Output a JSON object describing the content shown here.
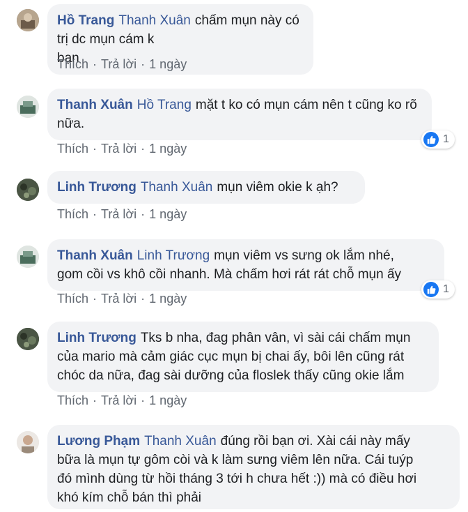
{
  "comments": [
    {
      "author": "Hồ Trang",
      "mention": "Thanh Xuân",
      "text_lines": [
        "chấm mụn này có trị dc mụn cám k",
        "bạn"
      ],
      "actions": {
        "like": "Thích",
        "reply": "Trả lời",
        "time": "1 ngày"
      },
      "reactions": null
    },
    {
      "author": "Thanh Xuân",
      "mention": "Hồ Trang",
      "text_lines": [
        "mặt t ko có mụn cám nên t cũng ko rõ",
        "nữa."
      ],
      "actions": {
        "like": "Thích",
        "reply": "Trả lời",
        "time": "1 ngày"
      },
      "reactions": {
        "icon": "like-icon",
        "count": "1"
      }
    },
    {
      "author": "Linh Trương",
      "mention": "Thanh Xuân",
      "text_lines": [
        "mụn viêm okie k ạh?"
      ],
      "actions": {
        "like": "Thích",
        "reply": "Trả lời",
        "time": "1 ngày"
      },
      "reactions": null
    },
    {
      "author": "Thanh Xuân",
      "mention": "Linh Trương",
      "text_lines": [
        "mụn viêm vs sưng ok lắm nhé,",
        "gom cồi vs khô cồi nhanh. Mà chấm hơi rát rát chỗ mụn ấy"
      ],
      "actions": {
        "like": "Thích",
        "reply": "Trả lời",
        "time": "1 ngày"
      },
      "reactions": {
        "icon": "like-icon",
        "count": "1"
      }
    },
    {
      "author": "Linh Trương",
      "mention": "",
      "text_lines": [
        "Tks b nha, đag phân vân, vì sài cái chấm mụn",
        "của mario mà cảm giác cục mụn bị chai ấy, bôi lên cũng rát",
        "chóc da nữa, đag sài dưỡng của floslek thấy cũng okie lắm"
      ],
      "actions": {
        "like": "Thích",
        "reply": "Trả lời",
        "time": "1 ngày"
      },
      "reactions": null
    },
    {
      "author": "Lương Phạm",
      "mention": "Thanh Xuân",
      "text_lines": [
        "đúng rồi bạn ơi. Xài cái này mấy",
        "bữa là mụn tự gôm còi và k làm sưng viêm lên nữa. Cái tuýp",
        "đó mình dùng từ hồi tháng 3 tới h chưa hết :)) mà có điều hơi",
        "khó kím chỗ bán thì phải"
      ],
      "actions": null,
      "reactions": null
    }
  ],
  "colors": {
    "author": "#385898",
    "bubble": "#f2f3f5",
    "action_text": "#606770",
    "like_badge": "#1877f2"
  }
}
